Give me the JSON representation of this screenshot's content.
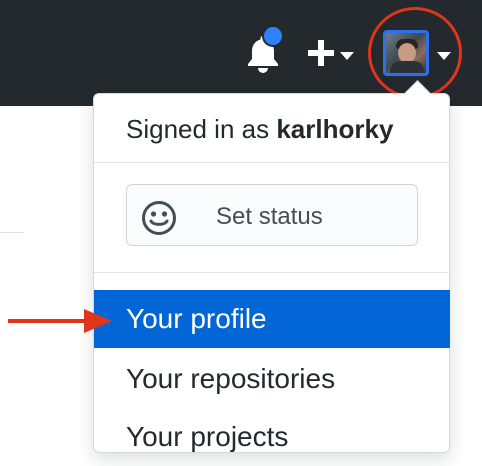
{
  "header": {
    "notifications_icon": "bell-icon",
    "new_icon": "plus-icon",
    "avatar_label": "user avatar"
  },
  "dropdown": {
    "signed_in_prefix": "Signed in as",
    "username": "karlhorky",
    "set_status_label": "Set status",
    "status_icon": "smiley-icon",
    "items": [
      {
        "label": "Your profile",
        "active": true
      },
      {
        "label": "Your repositories",
        "active": false
      },
      {
        "label": "Your projects",
        "active": false
      }
    ]
  },
  "annotations": {
    "highlight_color": "#e0341b",
    "active_color": "#0366d6",
    "header_color": "#24292e"
  }
}
